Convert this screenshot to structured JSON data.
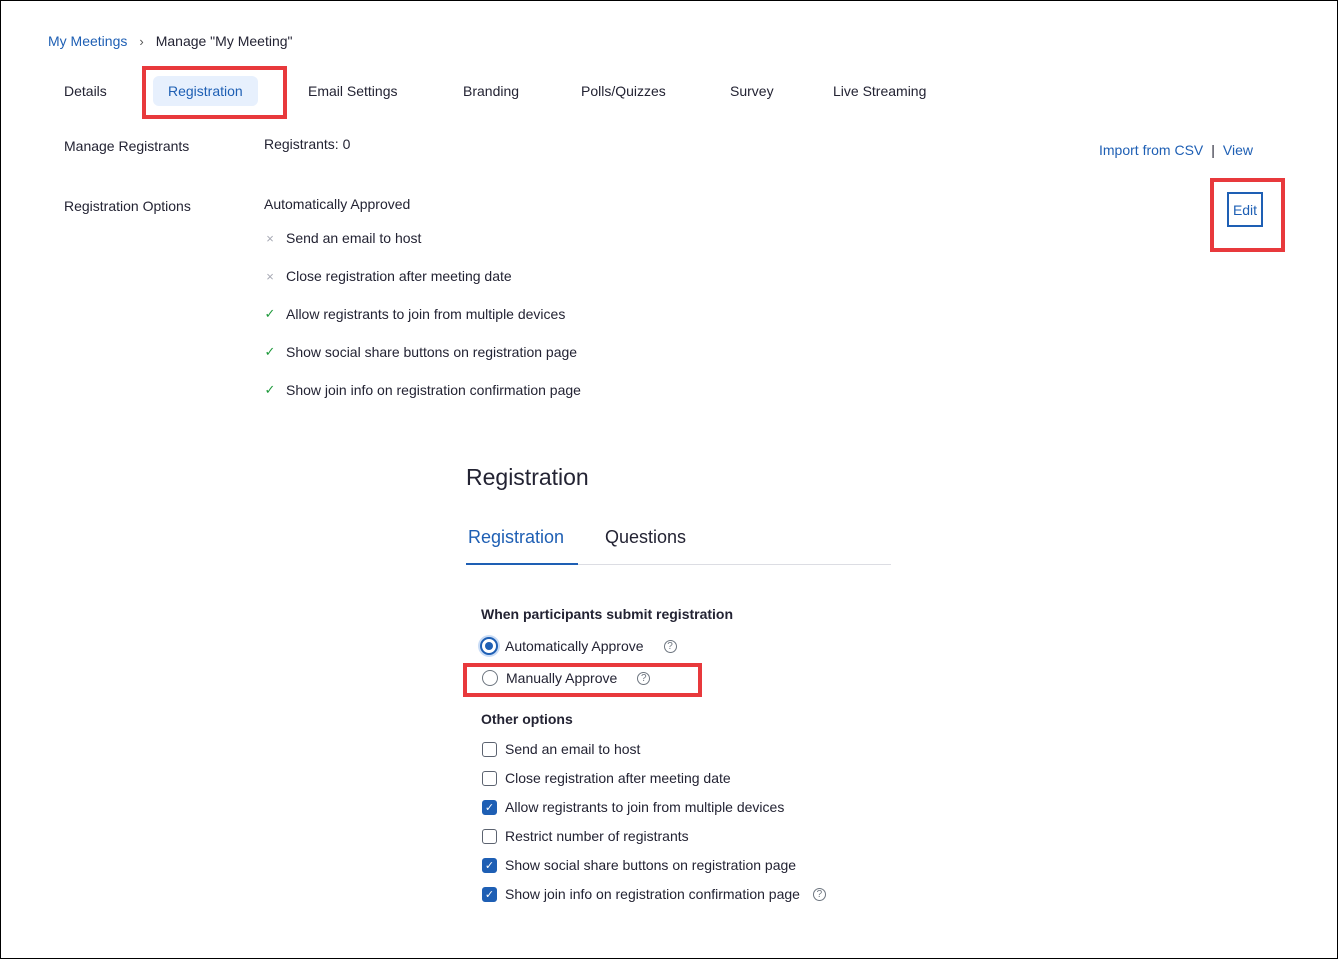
{
  "breadcrumb": {
    "home": "My Meetings",
    "separator": "›",
    "current": "Manage \"My Meeting\""
  },
  "tabs": [
    {
      "label": "Details"
    },
    {
      "label": "Registration"
    },
    {
      "label": "Email Settings"
    },
    {
      "label": "Branding"
    },
    {
      "label": "Polls/Quizzes"
    },
    {
      "label": "Survey"
    },
    {
      "label": "Live Streaming"
    }
  ],
  "active_tab": "Registration",
  "manage_registrants": {
    "label": "Manage Registrants",
    "count_text": "Registrants: 0",
    "import_link": "Import from CSV",
    "divider": "|",
    "view_link": "View"
  },
  "registration_options": {
    "label": "Registration Options",
    "approval": "Automatically Approved",
    "edit_label": "Edit",
    "items": [
      {
        "text": "Send an email to host",
        "enabled": false,
        "icon": "×"
      },
      {
        "text": "Close registration after meeting date",
        "enabled": false,
        "icon": "×"
      },
      {
        "text": "Allow registrants to join from multiple devices",
        "enabled": true,
        "icon": "✓"
      },
      {
        "text": "Show social share buttons on registration page",
        "enabled": true,
        "icon": "✓"
      },
      {
        "text": "Show join info on registration confirmation page",
        "enabled": true,
        "icon": "✓"
      }
    ]
  },
  "dialog": {
    "title": "Registration",
    "tabs": [
      {
        "label": "Registration"
      },
      {
        "label": "Questions"
      }
    ],
    "submit_heading": "When participants submit registration",
    "radios": [
      {
        "label": "Automatically Approve",
        "selected": true,
        "help": "?"
      },
      {
        "label": "Manually Approve",
        "selected": false,
        "help": "?"
      }
    ],
    "other_heading": "Other options",
    "checkboxes": [
      {
        "label": "Send an email to host",
        "checked": false
      },
      {
        "label": "Close registration after meeting date",
        "checked": false
      },
      {
        "label": "Allow registrants to join from multiple devices",
        "checked": true
      },
      {
        "label": "Restrict number of registrants",
        "checked": false
      },
      {
        "label": "Show social share buttons on registration page",
        "checked": true
      },
      {
        "label": "Show join info on registration confirmation page",
        "checked": true,
        "help": "?"
      }
    ],
    "check_glyph": "✓"
  },
  "colors": {
    "accent": "#1e5fb4",
    "highlight": "#e8393c",
    "ok": "#1f9a3c",
    "x": "#a7a9b4"
  }
}
